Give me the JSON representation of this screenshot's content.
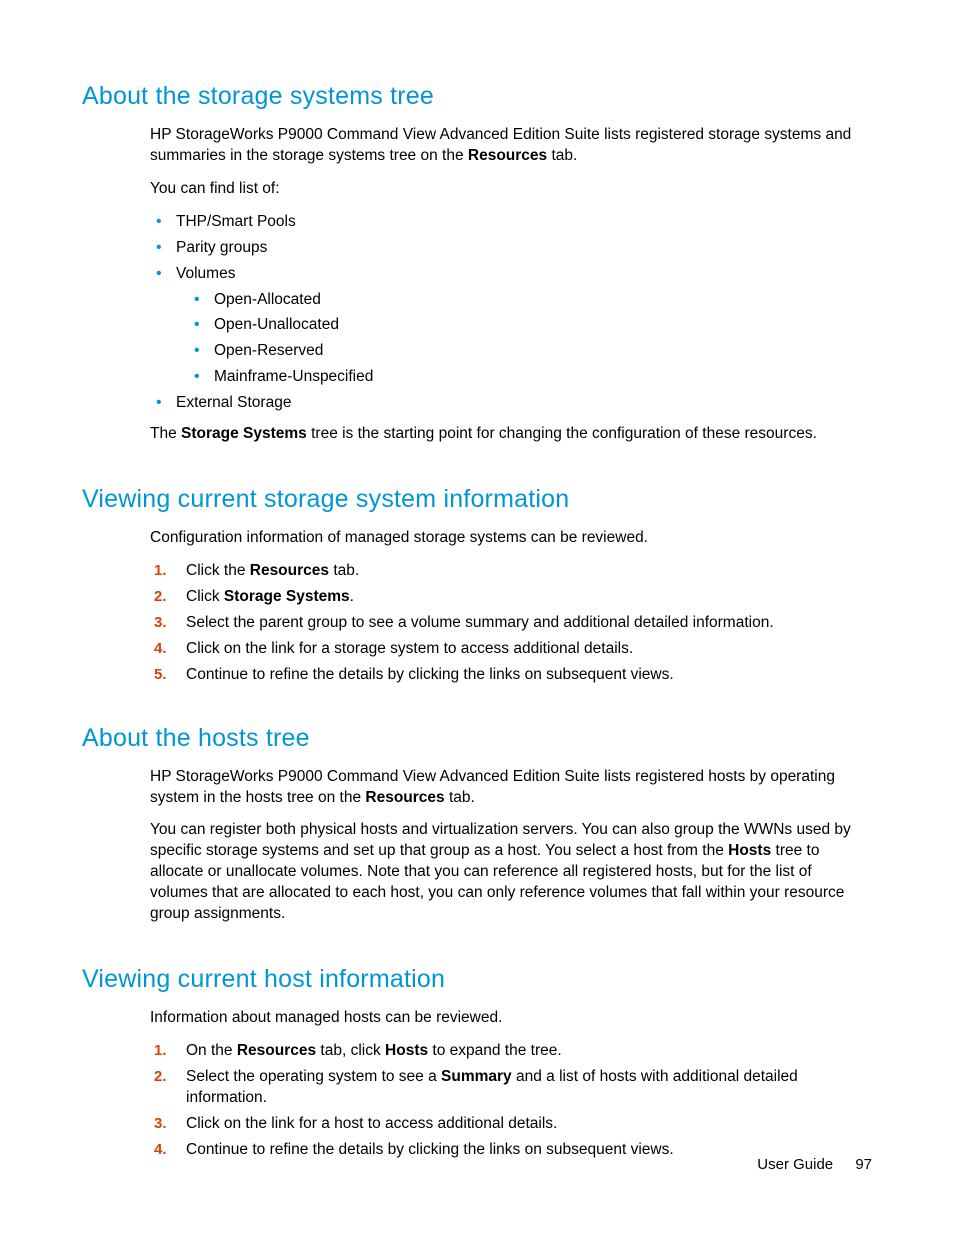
{
  "sections": [
    {
      "heading": "About the storage systems tree",
      "paragraphs_before": [
        "HP StorageWorks P9000 Command View Advanced Edition Suite lists registered storage systems and summaries in the storage systems tree on the <strong>Resources</strong> tab.",
        "You can find list of:"
      ],
      "bullets": [
        {
          "text": "THP/Smart Pools"
        },
        {
          "text": "Parity groups"
        },
        {
          "text": "Volumes",
          "children": [
            {
              "text": "Open-Allocated"
            },
            {
              "text": "Open-Unallocated"
            },
            {
              "text": "Open-Reserved"
            },
            {
              "text": "Mainframe-Unspecified"
            }
          ]
        },
        {
          "text": "External Storage"
        }
      ],
      "paragraphs_after": [
        "The <strong>Storage Systems</strong> tree is the starting point for changing the configuration of these resources."
      ]
    },
    {
      "heading": "Viewing current storage system information",
      "paragraphs_before": [
        "Configuration information of managed storage systems can be reviewed."
      ],
      "steps": [
        "Click the <strong>Resources</strong> tab.",
        "Click <strong>Storage Systems</strong>.",
        "Select the parent group to see a volume summary and additional detailed information.",
        "Click on the link for a storage system to access additional details.",
        "Continue to refine the details by clicking the links on subsequent views."
      ]
    },
    {
      "heading": "About the hosts tree",
      "paragraphs_before": [
        "HP StorageWorks P9000 Command View Advanced Edition Suite lists registered hosts by operating system in the hosts tree on the <strong>Resources</strong> tab.",
        "You can register both physical hosts and virtualization servers. You can also group the WWNs used by specific storage systems and set up that group as a host. You select a host from the <strong>Hosts</strong> tree to allocate or unallocate volumes. Note that you can reference all registered hosts, but for the list of volumes that are allocated to each host, you can only reference volumes that fall within your resource group assignments."
      ]
    },
    {
      "heading": "Viewing current host information",
      "paragraphs_before": [
        "Information about managed hosts can be reviewed."
      ],
      "steps": [
        "On the <strong>Resources</strong> tab, click <strong>Hosts</strong> to expand the tree.",
        "Select the operating system to see a <strong>Summary</strong> and a list of hosts with additional detailed information.",
        "Click on the link for a host to access additional details.",
        "Continue to refine the details by clicking the links on subsequent views."
      ]
    }
  ],
  "footer": {
    "label": "User Guide",
    "page": "97"
  }
}
